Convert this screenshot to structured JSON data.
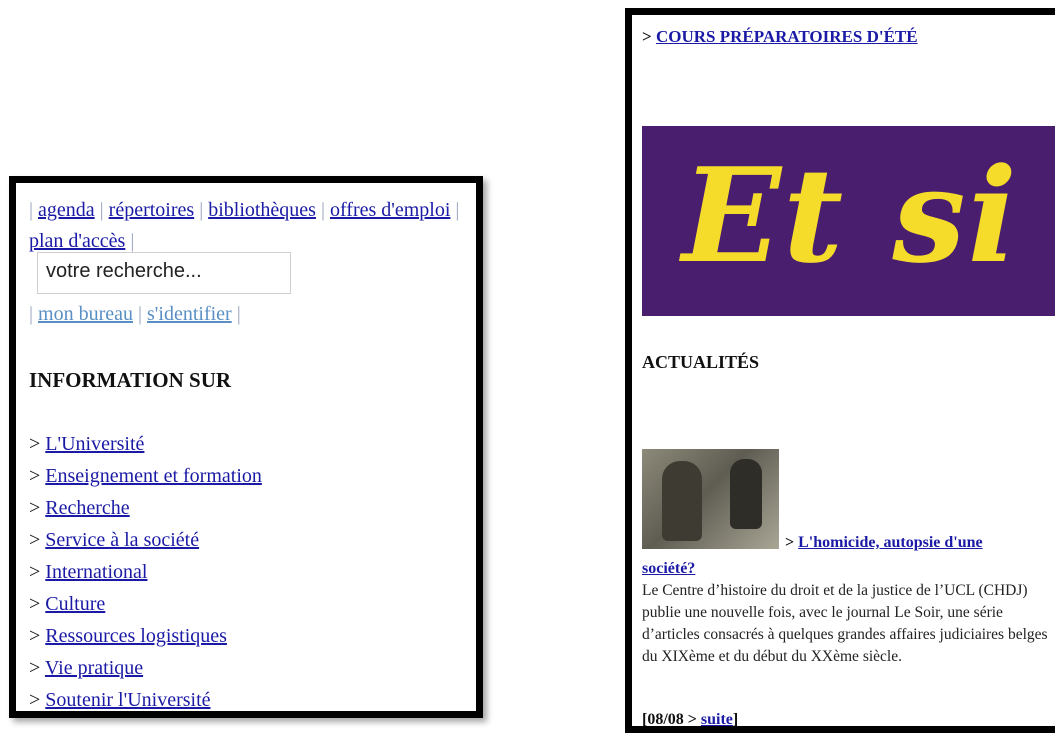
{
  "left_panel": {
    "top_links": [
      {
        "label": "agenda"
      },
      {
        "label": "répertoires"
      },
      {
        "label": "bibliothèques"
      },
      {
        "label": "offres d'emploi"
      },
      {
        "label": "plan d'accès"
      }
    ],
    "search": {
      "placeholder": "votre recherche..."
    },
    "account_links": [
      {
        "label": "mon bureau"
      },
      {
        "label": "s'identifier"
      }
    ],
    "separator": "|",
    "info_heading": "INFORMATION SUR",
    "info_items": [
      {
        "label": "L'Université"
      },
      {
        "label": "Enseignement et formation"
      },
      {
        "label": "Recherche"
      },
      {
        "label": "Service à la société"
      },
      {
        "label": "International"
      },
      {
        "label": "Culture"
      },
      {
        "label": "Ressources logistiques"
      },
      {
        "label": "Vie pratique"
      },
      {
        "label": "Soutenir l'Université"
      }
    ],
    "arrow": ">"
  },
  "right_panel": {
    "cours_link": "COURS PRÉPARATOIRES D'ÉTÉ",
    "banner_text": "Et si",
    "actualites_heading": "ACTUALITÉS",
    "news": {
      "title_part1": "L'homicide, autopsie d'une",
      "title_part2": "société?",
      "body": "Le Centre d’histoire du droit et de la justice de l’UCL (CHDJ) publie une nouvelle fois, avec le journal Le Soir, une série d’articles consacrés à quelques grandes affaires judiciaires belges du XIXème et du début du XXème siècle.",
      "date_prefix": "[08/08 >",
      "more_label": "suite",
      "date_suffix": "]"
    }
  },
  "colors": {
    "link": "#1a1aa6",
    "visited_link": "#5a8fc4",
    "banner_bg": "#4a1e6e",
    "banner_text": "#f5dc2a"
  }
}
